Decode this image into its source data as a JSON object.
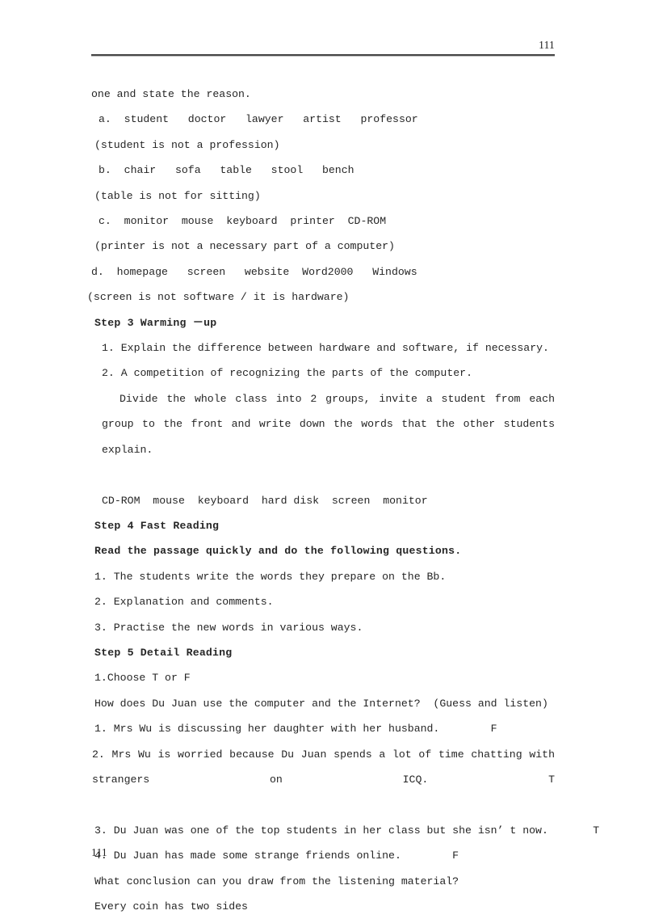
{
  "document": {
    "header_page_number": "111",
    "footer_page_number": "111"
  },
  "body": {
    "line_intro": "one and state the reason.",
    "item_a": "a.  student   doctor   lawyer   artist   professor",
    "item_a_note": "(student is not a profession)",
    "item_b": "b.  chair   sofa   table   stool   bench",
    "item_b_note": "(table is not for sitting)",
    "item_c": "c.  monitor  mouse  keyboard  printer  CD-ROM",
    "item_c_note": "(printer is not a necessary part of a computer)",
    "item_d": "d.  homepage   screen   website  Word2000   Windows",
    "item_d_note": "(screen is not software / it is hardware)",
    "step3_heading": "Step 3 Warming －up",
    "step3_item_1": "1. Explain the difference between hardware and software, if necessary.",
    "step3_item_2": "2. A competition of recognizing the parts of the computer.",
    "step3_para": "Divide the whole class into 2 groups, invite a student from each group to the front and write down the words that the other students explain.",
    "step3_wordlist": "CD-ROM  mouse  keyboard  hard disk  screen  monitor",
    "step4_heading": "Step 4 Fast Reading",
    "step4_instruction": "Read the passage quickly and do the following questions.",
    "step4_item_1": "1. The students write the words they prepare on the Bb.",
    "step4_item_2": "2. Explanation and comments.",
    "step4_item_3": "3. Practise the new words in various ways.",
    "step5_heading": "Step 5 Detail Reading",
    "step5_subheading": "1.Choose T or F",
    "step5_question": "How does Du Juan use the computer and the Internet?  (Guess and listen)",
    "tf_item_1": "1. Mrs Wu is discussing her daughter with her husband.        F",
    "tf_item_2_para": "2. Mrs Wu is worried because Du Juan spends a lot of time chatting with strangers on ICQ.   T",
    "tf_item_3": "3. Du Juan was one of the top students in her class but she isn’ t now.       T",
    "tf_item_4": "4. Du Juan has made some strange friends online.        F",
    "conclusion_question": "What conclusion can you draw from the listening material?",
    "conclusion_answer": "Every coin has two sides"
  }
}
